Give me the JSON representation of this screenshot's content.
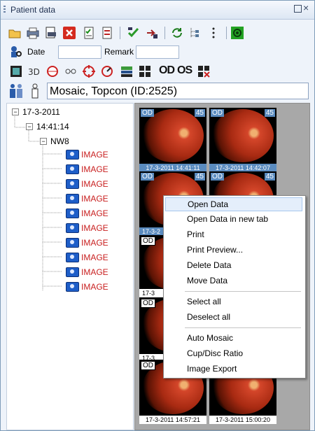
{
  "panel": {
    "title": "Patient data"
  },
  "filters": {
    "date_label": "Date",
    "date_value": "",
    "remark_label": "Remark",
    "remark_value": ""
  },
  "patient": {
    "name": "Mosaic, Topcon  (ID:2525)"
  },
  "tree": {
    "date": "17-3-2011",
    "time": "14:41:14",
    "device": "NW8",
    "items": [
      "IMAGE",
      "IMAGE",
      "IMAGE",
      "IMAGE",
      "IMAGE",
      "IMAGE",
      "IMAGE",
      "IMAGE",
      "IMAGE",
      "IMAGE"
    ]
  },
  "thumbnails": [
    {
      "eye": "OD",
      "angle": "45",
      "timestamp": "17-3-2011 14:41:11"
    },
    {
      "eye": "OD",
      "angle": "45",
      "timestamp": "17-3-2011 14:42:07"
    },
    {
      "eye": "OD",
      "angle": "45",
      "timestamp": "17-3-2"
    },
    {
      "eye": "OD",
      "angle": "45",
      "timestamp": ""
    },
    {
      "eye": "OD",
      "angle": "",
      "timestamp": ""
    },
    {
      "eye": "",
      "angle": "",
      "timestamp": "17-3"
    },
    {
      "eye": "OD",
      "angle": "",
      "timestamp": "17-3"
    },
    {
      "eye": "",
      "angle": "",
      "timestamp": ""
    },
    {
      "eye": "OD",
      "angle": "",
      "timestamp": "17-3-2011 14:57:21"
    },
    {
      "eye": "",
      "angle": "",
      "timestamp": "17-3-2011 15:00:20"
    }
  ],
  "context_menu": {
    "items": [
      "Open Data",
      "Open Data in new tab",
      "Print",
      "Print Preview...",
      "Delete Data",
      "Move Data",
      "Select all",
      "Deselect all",
      "Auto Mosaic",
      "Cup/Disc Ratio",
      "Image Export"
    ],
    "highlighted": "Open Data"
  },
  "toolbar2": {
    "od_label": "OD",
    "os_label": "OS"
  },
  "colors": {
    "accent": "#5a8bbf",
    "image_label": "#c81e1e",
    "panel_bg": "#eef3fa"
  }
}
